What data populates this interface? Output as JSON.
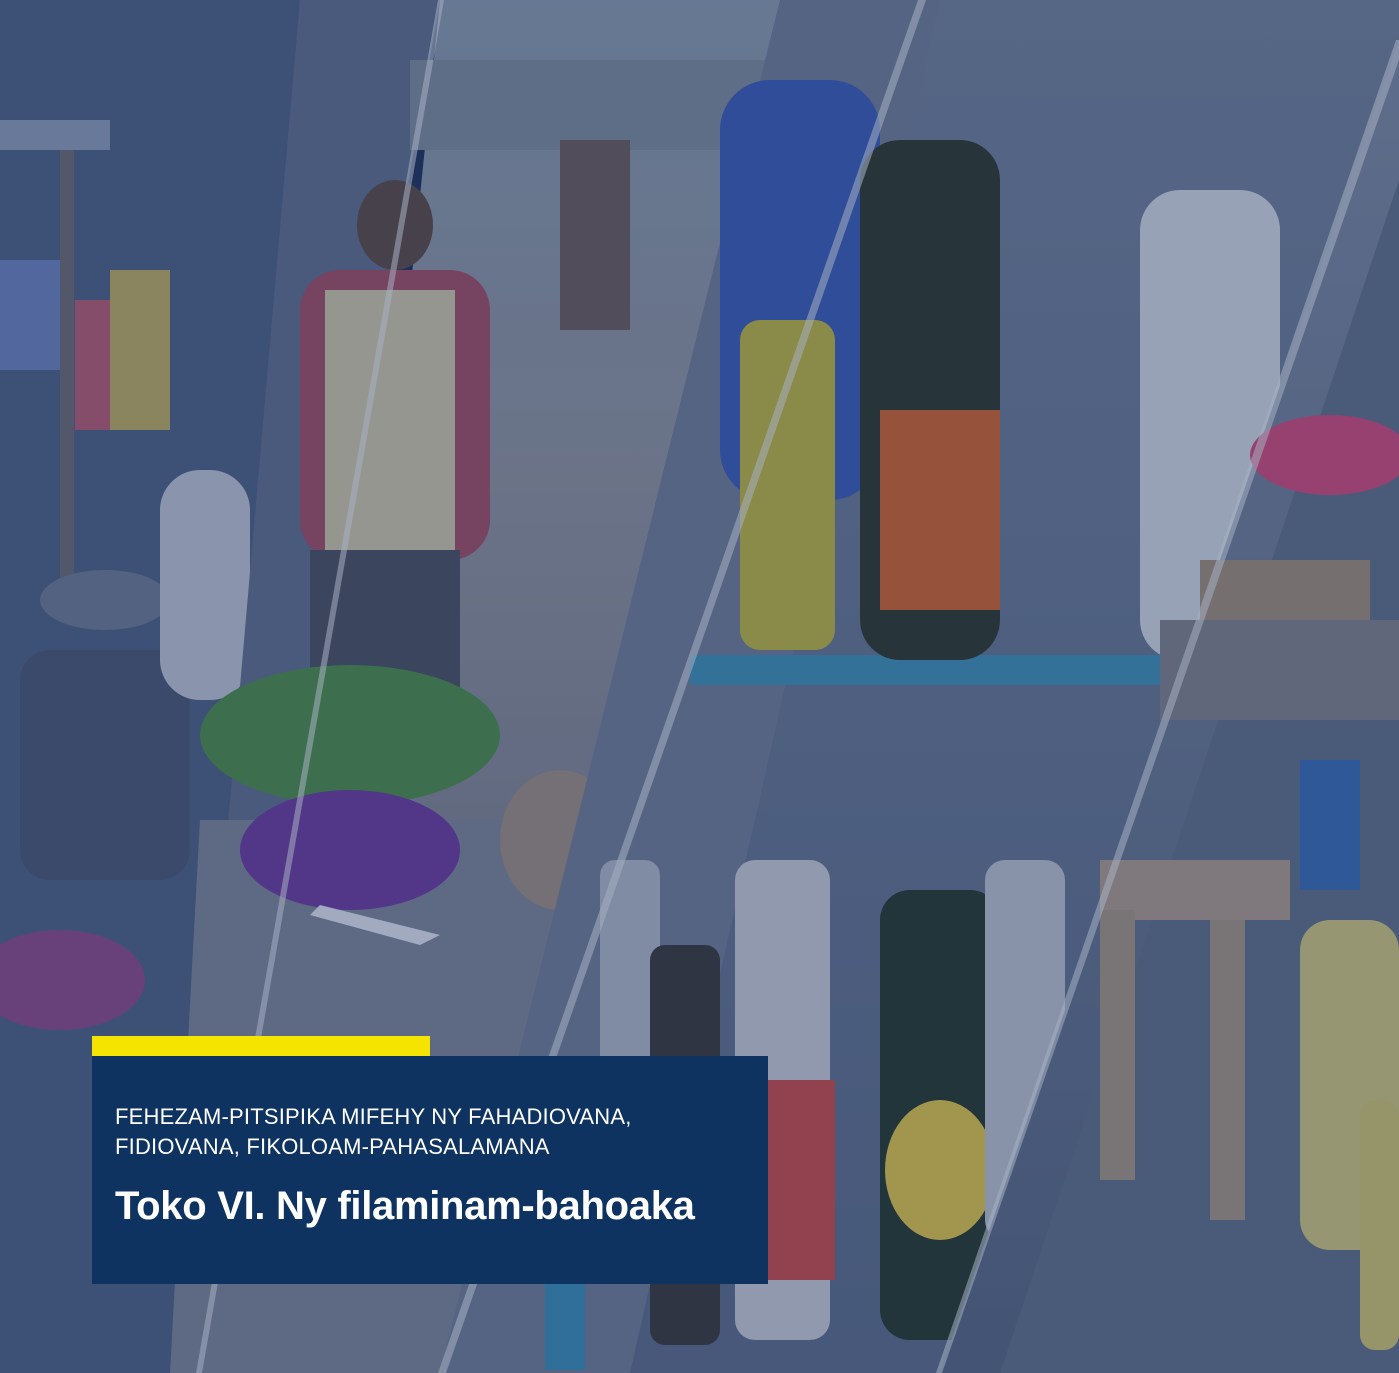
{
  "banner": {
    "subtitle_line1": "FEHEZAM-PITSIPIKA MIFEHY NY FAHADIOVANA,",
    "subtitle_line2": "FIDIOVANA, FIKOLOAM-PAHASALAMANA",
    "title": "Toko VI. Ny fi­laminam-bahoaka"
  },
  "colors": {
    "box_background": "#0e3361",
    "accent_bar": "#f5e400",
    "overlay_tint": "#162c5c"
  }
}
